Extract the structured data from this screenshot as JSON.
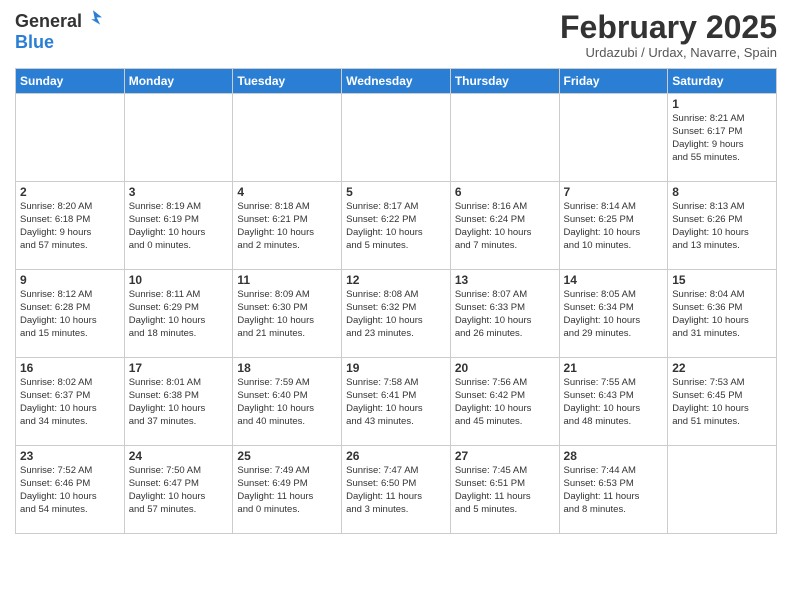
{
  "header": {
    "logo_line1": "General",
    "logo_line2": "Blue",
    "month": "February 2025",
    "location": "Urdazubi / Urdax, Navarre, Spain"
  },
  "weekdays": [
    "Sunday",
    "Monday",
    "Tuesday",
    "Wednesday",
    "Thursday",
    "Friday",
    "Saturday"
  ],
  "weeks": [
    [
      {
        "day": "",
        "info": ""
      },
      {
        "day": "",
        "info": ""
      },
      {
        "day": "",
        "info": ""
      },
      {
        "day": "",
        "info": ""
      },
      {
        "day": "",
        "info": ""
      },
      {
        "day": "",
        "info": ""
      },
      {
        "day": "1",
        "info": "Sunrise: 8:21 AM\nSunset: 6:17 PM\nDaylight: 9 hours\nand 55 minutes."
      }
    ],
    [
      {
        "day": "2",
        "info": "Sunrise: 8:20 AM\nSunset: 6:18 PM\nDaylight: 9 hours\nand 57 minutes."
      },
      {
        "day": "3",
        "info": "Sunrise: 8:19 AM\nSunset: 6:19 PM\nDaylight: 10 hours\nand 0 minutes."
      },
      {
        "day": "4",
        "info": "Sunrise: 8:18 AM\nSunset: 6:21 PM\nDaylight: 10 hours\nand 2 minutes."
      },
      {
        "day": "5",
        "info": "Sunrise: 8:17 AM\nSunset: 6:22 PM\nDaylight: 10 hours\nand 5 minutes."
      },
      {
        "day": "6",
        "info": "Sunrise: 8:16 AM\nSunset: 6:24 PM\nDaylight: 10 hours\nand 7 minutes."
      },
      {
        "day": "7",
        "info": "Sunrise: 8:14 AM\nSunset: 6:25 PM\nDaylight: 10 hours\nand 10 minutes."
      },
      {
        "day": "8",
        "info": "Sunrise: 8:13 AM\nSunset: 6:26 PM\nDaylight: 10 hours\nand 13 minutes."
      }
    ],
    [
      {
        "day": "9",
        "info": "Sunrise: 8:12 AM\nSunset: 6:28 PM\nDaylight: 10 hours\nand 15 minutes."
      },
      {
        "day": "10",
        "info": "Sunrise: 8:11 AM\nSunset: 6:29 PM\nDaylight: 10 hours\nand 18 minutes."
      },
      {
        "day": "11",
        "info": "Sunrise: 8:09 AM\nSunset: 6:30 PM\nDaylight: 10 hours\nand 21 minutes."
      },
      {
        "day": "12",
        "info": "Sunrise: 8:08 AM\nSunset: 6:32 PM\nDaylight: 10 hours\nand 23 minutes."
      },
      {
        "day": "13",
        "info": "Sunrise: 8:07 AM\nSunset: 6:33 PM\nDaylight: 10 hours\nand 26 minutes."
      },
      {
        "day": "14",
        "info": "Sunrise: 8:05 AM\nSunset: 6:34 PM\nDaylight: 10 hours\nand 29 minutes."
      },
      {
        "day": "15",
        "info": "Sunrise: 8:04 AM\nSunset: 6:36 PM\nDaylight: 10 hours\nand 31 minutes."
      }
    ],
    [
      {
        "day": "16",
        "info": "Sunrise: 8:02 AM\nSunset: 6:37 PM\nDaylight: 10 hours\nand 34 minutes."
      },
      {
        "day": "17",
        "info": "Sunrise: 8:01 AM\nSunset: 6:38 PM\nDaylight: 10 hours\nand 37 minutes."
      },
      {
        "day": "18",
        "info": "Sunrise: 7:59 AM\nSunset: 6:40 PM\nDaylight: 10 hours\nand 40 minutes."
      },
      {
        "day": "19",
        "info": "Sunrise: 7:58 AM\nSunset: 6:41 PM\nDaylight: 10 hours\nand 43 minutes."
      },
      {
        "day": "20",
        "info": "Sunrise: 7:56 AM\nSunset: 6:42 PM\nDaylight: 10 hours\nand 45 minutes."
      },
      {
        "day": "21",
        "info": "Sunrise: 7:55 AM\nSunset: 6:43 PM\nDaylight: 10 hours\nand 48 minutes."
      },
      {
        "day": "22",
        "info": "Sunrise: 7:53 AM\nSunset: 6:45 PM\nDaylight: 10 hours\nand 51 minutes."
      }
    ],
    [
      {
        "day": "23",
        "info": "Sunrise: 7:52 AM\nSunset: 6:46 PM\nDaylight: 10 hours\nand 54 minutes."
      },
      {
        "day": "24",
        "info": "Sunrise: 7:50 AM\nSunset: 6:47 PM\nDaylight: 10 hours\nand 57 minutes."
      },
      {
        "day": "25",
        "info": "Sunrise: 7:49 AM\nSunset: 6:49 PM\nDaylight: 11 hours\nand 0 minutes."
      },
      {
        "day": "26",
        "info": "Sunrise: 7:47 AM\nSunset: 6:50 PM\nDaylight: 11 hours\nand 3 minutes."
      },
      {
        "day": "27",
        "info": "Sunrise: 7:45 AM\nSunset: 6:51 PM\nDaylight: 11 hours\nand 5 minutes."
      },
      {
        "day": "28",
        "info": "Sunrise: 7:44 AM\nSunset: 6:53 PM\nDaylight: 11 hours\nand 8 minutes."
      },
      {
        "day": "",
        "info": ""
      }
    ]
  ]
}
